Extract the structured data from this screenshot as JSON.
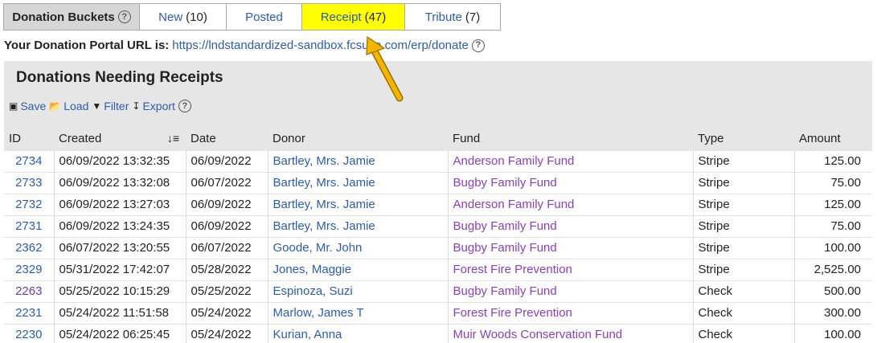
{
  "buckets": {
    "label": "Donation Buckets",
    "tabs": [
      {
        "label": "New",
        "count": "(10)",
        "active": false
      },
      {
        "label": "Posted",
        "count": "",
        "active": false
      },
      {
        "label": "Receipt",
        "count": "(47)",
        "active": true
      },
      {
        "label": "Tribute",
        "count": "(7)",
        "active": false
      }
    ]
  },
  "portal": {
    "label": "Your Donation Portal URL is:",
    "url": "https://lndstandardized-sandbox.fcsuite.com/erp/donate"
  },
  "panel": {
    "title": "Donations Needing Receipts",
    "toolbar": {
      "save": "Save",
      "load": "Load",
      "filter": "Filter",
      "export": "Export"
    }
  },
  "table": {
    "headers": [
      "ID",
      "Created",
      "Date",
      "Donor",
      "Fund",
      "Type",
      "Amount"
    ],
    "rows": [
      {
        "id": "2734",
        "created": "06/09/2022 13:32:35",
        "date": "06/09/2022",
        "donor": "Bartley, Mrs. Jamie",
        "fund": "Anderson Family Fund",
        "type": "Stripe",
        "amount": "125.00",
        "visited": false
      },
      {
        "id": "2733",
        "created": "06/09/2022 13:32:08",
        "date": "06/07/2022",
        "donor": "Bartley, Mrs. Jamie",
        "fund": "Bugby Family Fund",
        "type": "Stripe",
        "amount": "75.00",
        "visited": false
      },
      {
        "id": "2732",
        "created": "06/09/2022 13:27:03",
        "date": "06/09/2022",
        "donor": "Bartley, Mrs. Jamie",
        "fund": "Anderson Family Fund",
        "type": "Stripe",
        "amount": "125.00",
        "visited": false
      },
      {
        "id": "2731",
        "created": "06/09/2022 13:24:35",
        "date": "06/09/2022",
        "donor": "Bartley, Mrs. Jamie",
        "fund": "Bugby Family Fund",
        "type": "Stripe",
        "amount": "75.00",
        "visited": false
      },
      {
        "id": "2362",
        "created": "06/07/2022 13:20:55",
        "date": "06/07/2022",
        "donor": "Goode, Mr. John",
        "fund": "Bugby Family Fund",
        "type": "Stripe",
        "amount": "100.00",
        "visited": false
      },
      {
        "id": "2329",
        "created": "05/31/2022 17:42:07",
        "date": "05/28/2022",
        "donor": "Jones, Maggie",
        "fund": "Forest Fire Prevention",
        "type": "Stripe",
        "amount": "2,525.00",
        "visited": false
      },
      {
        "id": "2263",
        "created": "05/25/2022 10:15:29",
        "date": "05/25/2022",
        "donor": "Espinoza, Suzi",
        "fund": "Bugby Family Fund",
        "type": "Check",
        "amount": "500.00",
        "visited": true
      },
      {
        "id": "2231",
        "created": "05/24/2022 11:51:58",
        "date": "05/24/2022",
        "donor": "Marlow, James T",
        "fund": "Forest Fire Prevention",
        "type": "Check",
        "amount": "300.00",
        "visited": false
      },
      {
        "id": "2230",
        "created": "05/24/2022 06:25:45",
        "date": "05/24/2022",
        "donor": "Kurian, Anna",
        "fund": "Muir Woods Conservation Fund",
        "type": "Check",
        "amount": "100.00",
        "visited": false
      }
    ]
  },
  "colors": {
    "link": "#2a5db0",
    "fund": "#8a3ec4",
    "active_tab": "#ffff00",
    "arrow": "#f5b400"
  }
}
